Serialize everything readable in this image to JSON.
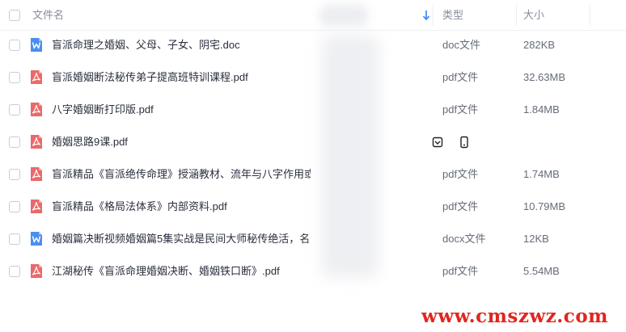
{
  "header": {
    "name_label": "文件名",
    "type_label": "类型",
    "size_label": "大小"
  },
  "files": [
    {
      "name": "盲派命理之婚姻、父母、子女、阴宅.doc",
      "type": "doc文件",
      "size": "282KB",
      "icon": "word-icon"
    },
    {
      "name": "盲派婚姻断法秘传弟子提高班特训课程.pdf",
      "type": "pdf文件",
      "size": "32.63MB",
      "icon": "pdf-icon"
    },
    {
      "name": "八字婚姻断打印版.pdf",
      "type": "pdf文件",
      "size": "1.84MB",
      "icon": "pdf-icon"
    },
    {
      "name": "婚姻思路9课.pdf",
      "type": "",
      "size": "",
      "icon": "pdf-icon"
    },
    {
      "name": "盲派精品《盲派绝传命理》授涵教材、流年与八字作用或...",
      "type": "pdf文件",
      "size": "1.74MB",
      "icon": "pdf-icon"
    },
    {
      "name": "盲派精品《格局法体系》内部资料.pdf",
      "type": "pdf文件",
      "size": "10.79MB",
      "icon": "pdf-icon"
    },
    {
      "name": "婚姻篇决断视频婚姻篇5集实战是民间大师秘传绝活，名...",
      "type": "docx文件",
      "size": "12KB",
      "icon": "word-icon"
    },
    {
      "name": "江湖秘传《盲派命理婚姻决断、婚姻铁口断》.pdf",
      "type": "pdf文件",
      "size": "5.54MB",
      "icon": "pdf-icon"
    }
  ],
  "hover_actions": [
    "save-to-netdisk-icon",
    "send-to-phone-icon"
  ],
  "watermark": "www.cmszwz.com",
  "colors": {
    "pdf_icon": "#e86a6a",
    "word_icon": "#4a8ef0",
    "watermark": "#e0261f",
    "header_text": "#878c9c"
  }
}
